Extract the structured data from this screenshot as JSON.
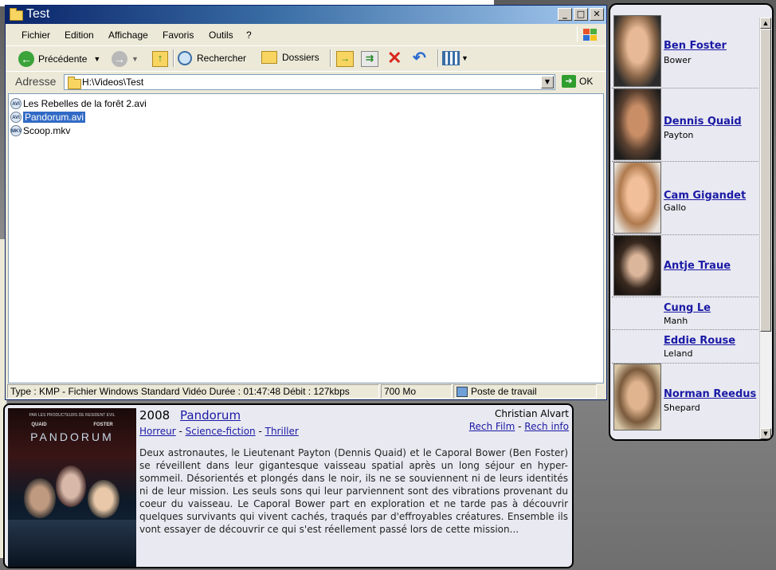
{
  "window": {
    "title": "Test",
    "menu": [
      "Fichier",
      "Edition",
      "Affichage",
      "Favoris",
      "Outils",
      "?"
    ],
    "toolbar": {
      "back": "Précédente",
      "search": "Rechercher",
      "folders": "Dossiers"
    },
    "address": {
      "label": "Adresse",
      "value": "H:\\Videos\\Test",
      "go": "OK"
    },
    "files": [
      {
        "name": "Les Rebelles de la forêt 2.avi",
        "icon": "avi-file-icon",
        "selected": false
      },
      {
        "name": "Pandorum.avi",
        "icon": "avi-file-icon",
        "selected": true
      },
      {
        "name": "Scoop.mkv",
        "icon": "mkv-file-icon",
        "selected": false
      }
    ],
    "status": {
      "info": "Type : KMP - Fichier Windows Standard Vidéo Durée : 01:47:48 Débit : 127kbps",
      "size": "700 Mo",
      "zone": "Poste de travail"
    }
  },
  "cast": [
    {
      "name": "Ben Foster",
      "role": "Bower",
      "photo": true
    },
    {
      "name": "Dennis Quaid",
      "role": "Payton",
      "photo": true
    },
    {
      "name": "Cam Gigandet",
      "role": "Gallo",
      "photo": true
    },
    {
      "name": "Antje Traue",
      "role": "",
      "photo": true
    },
    {
      "name": "Cung Le",
      "role": "Manh",
      "photo": false
    },
    {
      "name": "Eddie Rouse",
      "role": "Leland",
      "photo": false
    },
    {
      "name": "Norman Reedus",
      "role": "Shepard",
      "photo": true
    }
  ],
  "movie": {
    "year": "2008",
    "title": "Pandorum",
    "genres": [
      "Horreur",
      "Science-fiction",
      "Thriller"
    ],
    "director": "Christian Alvart",
    "links": [
      "Rech Film",
      "Rech info"
    ],
    "description": "Deux astronautes, le Lieutenant Payton (Dennis Quaid) et le Caporal Bower (Ben Foster) se réveillent dans leur gigantesque vaisseau spatial après un long séjour en hyper-sommeil. Désorientés et plongés dans le noir, ils ne se souviennent ni de leurs identités ni de leur mission. Les seuls sons qui leur parviennent sont des vibrations provenant du coeur du vaisseau. Le Caporal Bower part en exploration et ne tarde pas à découvrir quelques survivants qui vivent cachés, traqués par d'effroyables créatures. Ensemble ils vont essayer de découvrir ce qui s'est réellement passé lors de cette mission...",
    "poster": {
      "tagline": "PAR LES PRODUCTEURS DE RESIDENT EVIL",
      "names": [
        "QUAID",
        "FOSTER"
      ],
      "title": "PANDORUM"
    }
  }
}
